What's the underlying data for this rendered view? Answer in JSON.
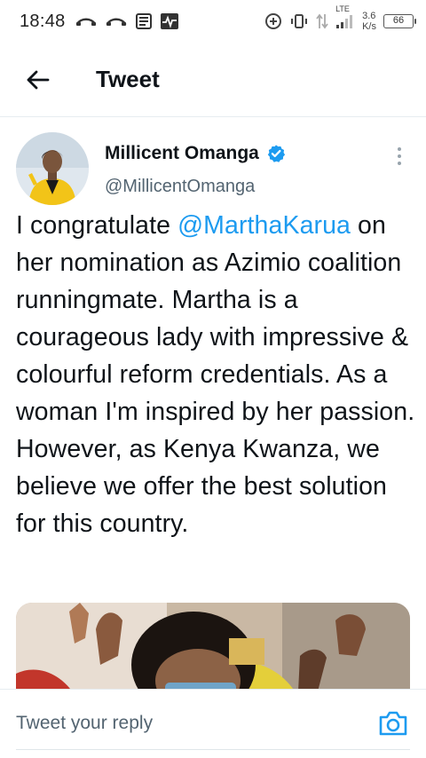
{
  "status_bar": {
    "time": "18:48",
    "network_type": "LTE",
    "speed_value": "3.6",
    "speed_unit": "K/s",
    "battery": "66"
  },
  "header": {
    "title": "Tweet",
    "back_icon": "arrow-left-icon"
  },
  "tweet": {
    "author_name": "Millicent Omanga",
    "handle": "@MillicentOmanga",
    "verified_icon": "verified-badge-icon",
    "text_segments": {
      "mention": "@MarthaKarua",
      "intro": "I congratulate ",
      "body": "on her nomination as Azimio coalition runningmate. Martha is a courageous lady with impressive & colourful reform credentials. As a woman I'm inspired by her passion. However, as Kenya Kwanza, we believe we offer the best solution for this country."
    }
  },
  "reply_bar": {
    "placeholder": "Tweet your reply",
    "camera_icon": "camera-icon"
  },
  "colors": {
    "accent": "#1d9bf0",
    "text": "#0f1419",
    "secondary_text": "#536471"
  }
}
